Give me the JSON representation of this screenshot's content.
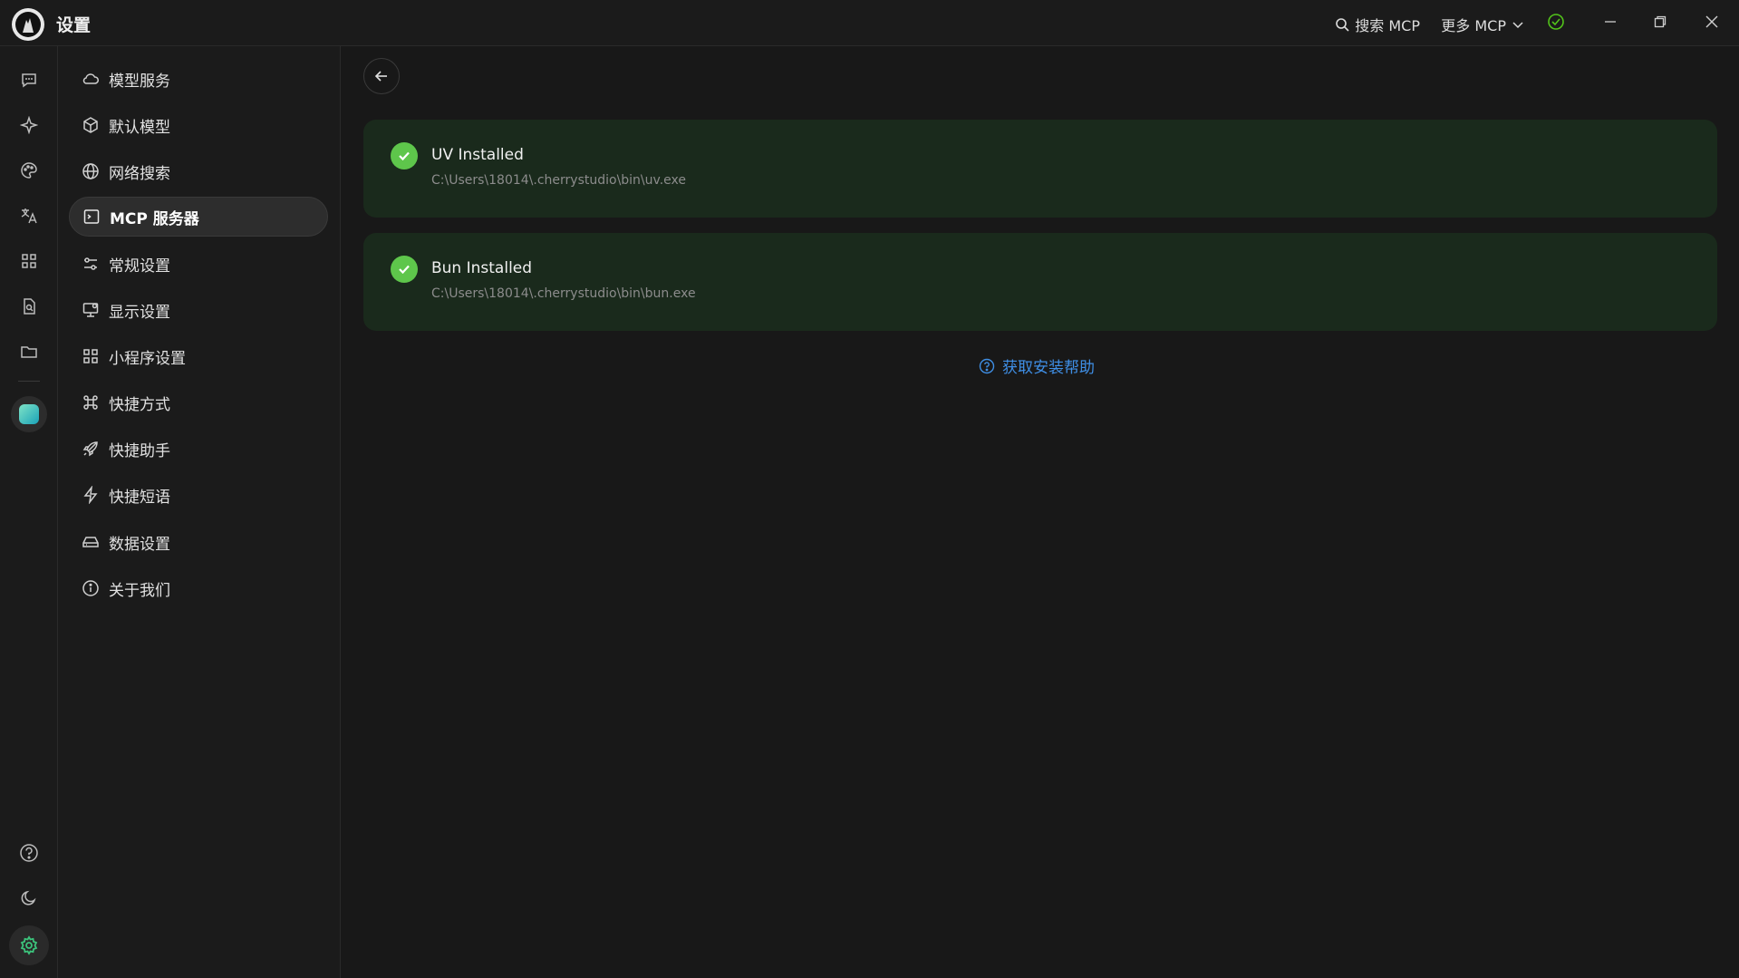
{
  "titlebar": {
    "app_title": "设置",
    "search_label": "搜索 MCP",
    "more_label": "更多 MCP",
    "status_color": "#52c41a"
  },
  "rail": {
    "icons": [
      "chat-icon",
      "sparkle-icon",
      "palette-icon",
      "translate-icon",
      "apps-icon",
      "document-icon",
      "folder-icon"
    ],
    "bottom_icons": [
      "help-icon",
      "moon-icon",
      "gear-icon"
    ]
  },
  "menu": {
    "items": [
      {
        "label": "模型服务",
        "icon": "cloud-icon"
      },
      {
        "label": "默认模型",
        "icon": "cube-icon"
      },
      {
        "label": "网络搜索",
        "icon": "globe-icon"
      },
      {
        "label": "MCP 服务器",
        "icon": "terminal-icon",
        "active": true
      },
      {
        "label": "常规设置",
        "icon": "settings-sliders-icon"
      },
      {
        "label": "显示设置",
        "icon": "monitor-icon"
      },
      {
        "label": "小程序设置",
        "icon": "grid-icon"
      },
      {
        "label": "快捷方式",
        "icon": "command-icon"
      },
      {
        "label": "快捷助手",
        "icon": "rocket-icon"
      },
      {
        "label": "快捷短语",
        "icon": "lightning-icon"
      },
      {
        "label": "数据设置",
        "icon": "drive-icon"
      },
      {
        "label": "关于我们",
        "icon": "info-icon"
      }
    ]
  },
  "main": {
    "cards": [
      {
        "title": "UV Installed",
        "path": "C:\\Users\\18014\\.cherrystudio\\bin\\uv.exe"
      },
      {
        "title": "Bun Installed",
        "path": "C:\\Users\\18014\\.cherrystudio\\bin\\bun.exe"
      }
    ],
    "help_link": "获取安装帮助"
  },
  "colors": {
    "accent": "#3f8fe6",
    "success": "#5ec64b",
    "card_bg": "#1a2a1c",
    "settings_icon": "#3cc47c"
  }
}
